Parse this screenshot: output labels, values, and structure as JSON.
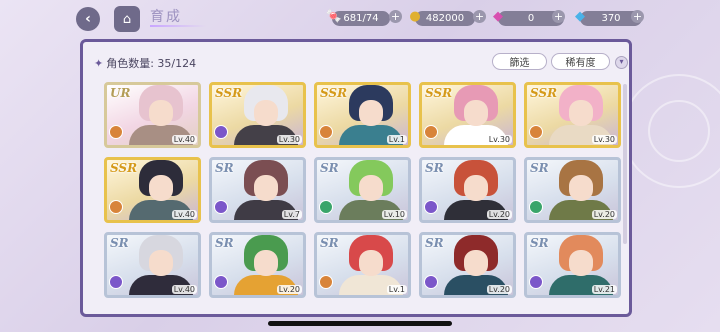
{
  "header": {
    "back_glyph": "‹",
    "home_glyph": "⌂",
    "title": "育成"
  },
  "resources": [
    {
      "name": "candy",
      "icon": "candy-icon",
      "glyph": "🍬",
      "value": "681/74",
      "color": "#e05a7a"
    },
    {
      "name": "coin",
      "icon": "coin-icon",
      "glyph": "●",
      "value": "482000",
      "color": "#e0b030"
    },
    {
      "name": "gem-pink",
      "icon": "pink-gem-icon",
      "glyph": "◆",
      "value": "0",
      "color": "#d84fb0"
    },
    {
      "name": "gem-blue",
      "icon": "blue-gem-icon",
      "glyph": "◆",
      "value": "370",
      "color": "#4ab2e8"
    }
  ],
  "panel": {
    "count_label": "角色数量: 35/124",
    "filter_label": "篩选",
    "sort_label": "稀有度"
  },
  "cards": [
    {
      "rarity": "UR",
      "rclass": "ur",
      "level": "Lv.40",
      "attr": "#d8843a",
      "hair": "#e7c3cf",
      "outfit": "#a88f84"
    },
    {
      "rarity": "SSR",
      "rclass": "ssr",
      "level": "Lv.30",
      "attr": "#7b57c9",
      "hair": "#e8e8ee",
      "outfit": "#444048"
    },
    {
      "rarity": "SSR",
      "rclass": "ssr",
      "level": "Lv.1",
      "attr": "#d8843a",
      "hair": "#2c3a5e",
      "outfit": "#3a7f8f"
    },
    {
      "rarity": "SSR",
      "rclass": "ssr",
      "level": "Lv.30",
      "attr": "#d8843a",
      "hair": "#e79ab5",
      "outfit": "#ffffff"
    },
    {
      "rarity": "SSR",
      "rclass": "ssr",
      "level": "Lv.30",
      "attr": "#d8843a",
      "hair": "#f2b1c8",
      "outfit": "#e9dac4"
    },
    {
      "rarity": "SSR",
      "rclass": "ssr",
      "level": "Lv.40",
      "attr": "#d8843a",
      "hair": "#2d2c3a",
      "outfit": "#556a70"
    },
    {
      "rarity": "SR",
      "rclass": "sr",
      "level": "Lv.7",
      "attr": "#7b57c9",
      "hair": "#7b4e52",
      "outfit": "#3f3b45"
    },
    {
      "rarity": "SR",
      "rclass": "sr",
      "level": "Lv.10",
      "attr": "#3aa56a",
      "hair": "#84c95c",
      "outfit": "#6b7d5c"
    },
    {
      "rarity": "SR",
      "rclass": "sr",
      "level": "Lv.20",
      "attr": "#7b57c9",
      "hair": "#c8523a",
      "outfit": "#2f2f38"
    },
    {
      "rarity": "SR",
      "rclass": "sr",
      "level": "Lv.20",
      "attr": "#3aa56a",
      "hair": "#a87443",
      "outfit": "#6f7a48"
    },
    {
      "rarity": "SR",
      "rclass": "sr",
      "level": "Lv.40",
      "attr": "#7b57c9",
      "hair": "#d7d7df",
      "outfit": "#2f2c3b"
    },
    {
      "rarity": "SR",
      "rclass": "sr",
      "level": "Lv.20",
      "attr": "#7b57c9",
      "hair": "#4a9b4f",
      "outfit": "#e5a233"
    },
    {
      "rarity": "SR",
      "rclass": "sr",
      "level": "Lv.1",
      "attr": "#d8843a",
      "hair": "#d8494a",
      "outfit": "#f0e6d6"
    },
    {
      "rarity": "SR",
      "rclass": "sr",
      "level": "Lv.20",
      "attr": "#7b57c9",
      "hair": "#8e2a2a",
      "outfit": "#2a4f63"
    },
    {
      "rarity": "SR",
      "rclass": "sr",
      "level": "Lv.21",
      "attr": "#7b57c9",
      "hair": "#e28a5c",
      "outfit": "#2f6d6a"
    }
  ]
}
